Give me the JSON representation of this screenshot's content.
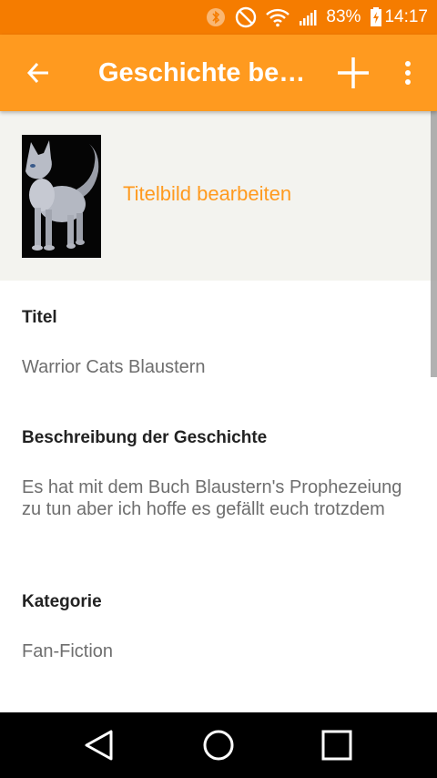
{
  "status_bar": {
    "battery_percent": "83%",
    "time": "14:17",
    "icons": [
      "bluetooth-icon",
      "do-not-disturb-icon",
      "wifi-icon",
      "signal-icon",
      "battery-icon"
    ]
  },
  "app_bar": {
    "title": "Geschichte bearbeiten",
    "icons": [
      "back-arrow-icon",
      "plus-icon",
      "more-vert-icon"
    ],
    "color": "#ff9a1f"
  },
  "cover": {
    "edit_label": "Titelbild bearbeiten"
  },
  "fields": {
    "title": {
      "label": "Titel",
      "value": "Warrior Cats Blaustern"
    },
    "description": {
      "label": "Beschreibung der Geschichte",
      "value": "Es hat mit dem Buch Blaustern's Prophezeiung zu tun aber ich hoffe es gefällt euch trotzdem"
    },
    "category": {
      "label": "Kategorie",
      "value": "Fan-Fiction"
    }
  },
  "nav_bar": {
    "icons": [
      "nav-back-icon",
      "nav-home-icon",
      "nav-recents-icon"
    ]
  }
}
